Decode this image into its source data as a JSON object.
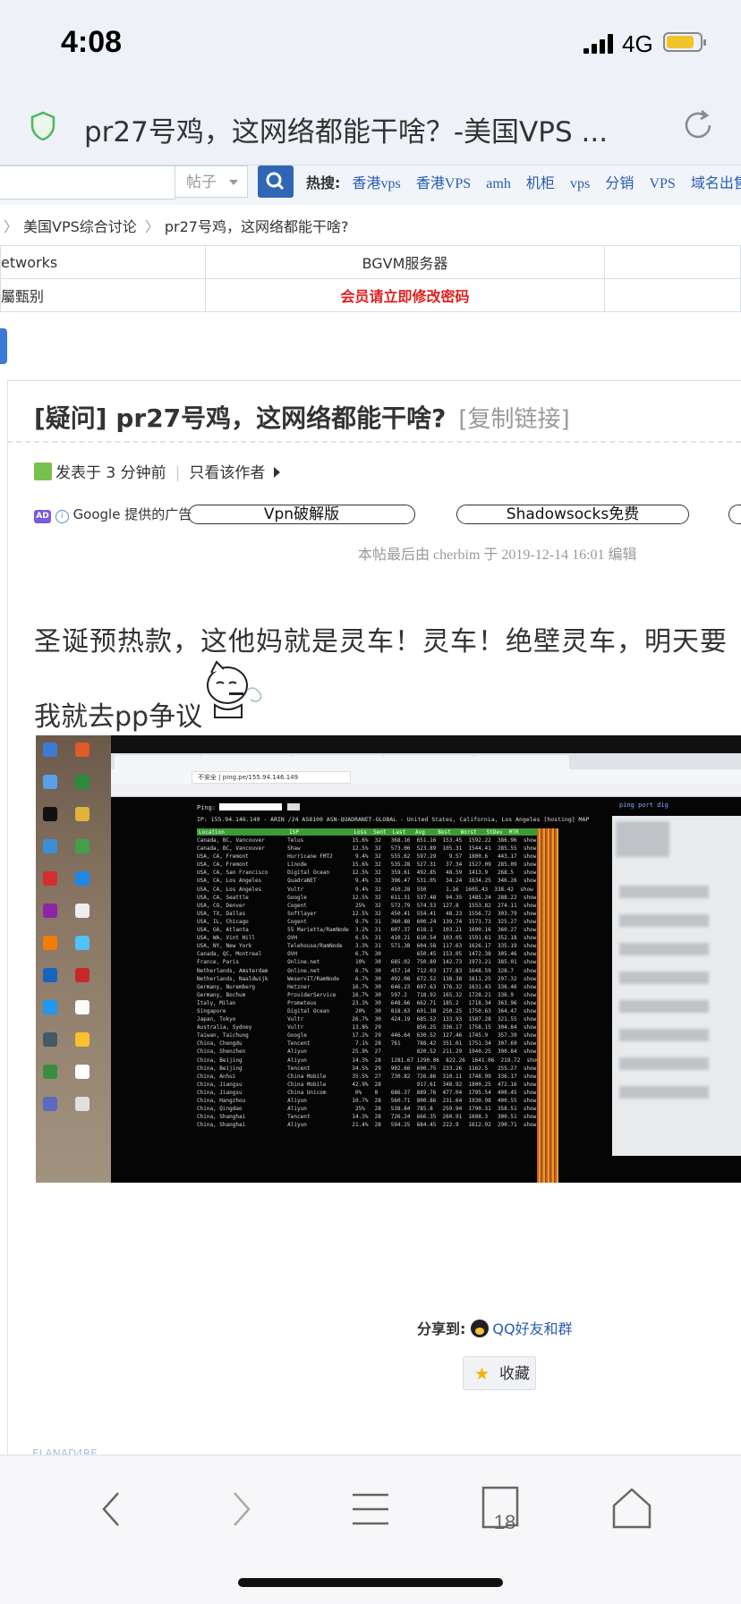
{
  "status": {
    "time": "4:08",
    "network": "4G"
  },
  "browser": {
    "page_title": "pr27号鸡，这网络都能干啥？-美国VPS ..."
  },
  "site_search": {
    "scope": "帖子",
    "hot_label": "热搜:",
    "hot_words": [
      "香港vps",
      "香港VPS",
      "amh",
      "机柜",
      "vps",
      "分销",
      "VPS",
      "域名出售",
      "比"
    ]
  },
  "breadcrumb": [
    "美国VPS综合讨论",
    "pr27号鸡，这网络都能干啥?"
  ],
  "links_table": {
    "row1": [
      "etworks",
      "BGVM服务器"
    ],
    "row2": [
      "屬甄别",
      "会员请立即修改密码"
    ]
  },
  "post": {
    "title": "[疑问] pr27号鸡，这网络都能干啥?",
    "copy_link": "[复制链接]",
    "posted": "发表于 3 分钟前",
    "only_author": "只看该作者",
    "ad": {
      "badge": "AD",
      "provider": "Google 提供的广告",
      "pills": [
        "Vpn破解版",
        "Shadowsocks免费"
      ]
    },
    "edit_note": "本帖最后由 cherbim 于 2019-12-14 16:01 编辑",
    "body_line1": "圣诞预热款，这他妈就是灵车！灵车！绝壁灵车，明天要",
    "body_line2": "我就去pp争议"
  },
  "embedded_screenshot": {
    "url": "不安全 | ping.pe/155.94.146.149",
    "ping_label": "Ping:",
    "ping_value": "155.94.1",
    "go_label": "Go",
    "right_links": "ping  port  dig",
    "ip_line": "IP: 155.94.146.149 - ARIN /24 AS8100 ASN-QUADRANET-GLOBAL - United States, California, Los Angeles [hosting] MAP",
    "header": "Location                    ISP                 Loss  Sent  Last   Avg    Best   Worst   StDev  MTR",
    "rows": [
      "Canada, BC, Vancouver       Telus               15.6%  32   368.16  651.16  153.45  1592.22  386.96  show",
      "Canada, BC, Vancouver       Shaw                12.5%  32   573.06  523.89  105.31  1544.41  285.55  show",
      "USA, CA, Fremont            Hurricane FMT2       9.4%  32   555.62  597.29    9.57  1800.6   443.17  show",
      "USA, CA, Fremont            Linode              15.6%  32   535.28  527.31   37.34  1527.09  285.09  show",
      "USA, CA, San Francisco      Digital Ocean       12.5%  32   359.61  492.85   48.59  1413.9   268.5   show",
      "USA, CA, Los Angeles        QuadraNET            9.4%  32   396.47  531.05   34.24  1634.25  346.26  show",
      "USA, CA, Los Angeles        Vultr                9.4%  32   410.28  550      1.16  1605.43  338.42  show",
      "USA, CA, Seattle            Google              12.5%  32   611.31  537.48   94.35  1485.24  288.22  show",
      "USA, CO, Denver             Cogent               25%   32   572.79  574.53  127.8   1553.82  274.11  show",
      "USA, TX, Dallas             Softlayer           12.5%  32   450.41  554.41   48.23  1556.72  303.79  show",
      "USA, IL, Chicago            Cogent               9.7%  31   360.88  600.24  139.74  1573.73  325.27  show",
      "USA, GA, Atlanta            55 Marietta/RamNode  3.2%  31   607.37  618.1   103.21  1690.16  360.27  show",
      "USA, WA, Vint Hill          OVH                  6.5%  31   410.21  610.54  103.05  1591.61  352.18  show",
      "USA, NY, New York           Telehouse/RamNode    3.3%  31   571.38  604.58  117.63  1626.17  335.19  show",
      "Canada, QC, Montreal        OVH                  6.7%  30           650.45  153.05  1472.38  305.46  show",
      "France, Paris               Online.net           10%   30   685.02  750.89  142.73  1973.21  385.01  show",
      "Netherlands, Amsterdam      Online.net           6.7%  30   457.14  712.03  177.83  1648.59  328.7   show",
      "Netherlands, Naaldwijk      WeservIT/RamNode     6.7%  30   492.08  672.52  138.38  1611.25  297.32  show",
      "Germany, Nuremberg          Hetzner             16.7%  30   646.23  697.63  176.32  1631.43  336.46  show",
      "Germany, Bochum             ProviderService     16.7%  30   597.2   718.92  165.32  1728.21  336.9   show",
      "Italy, Milan                Prometeus           23.3%  30   648.66  662.71  185.2   1718.34  363.96  show",
      "Singapore                   Digital Ocean        20%   30   818.63  691.38  250.25  1750.63  364.47  show",
      "Japan, Tokyo                Vultr               26.7%  30   424.19  685.52  133.93  1587.28  321.55  show",
      "Australia, Sydney           Vultr               13.8%  29           856.25  336.17  1758.15  304.84  show",
      "Taiwan, Taichung            Google              17.2%  29   446.64  630.52  127.46  1745.9   357.39  show",
      "China, Chengdu              Tencent              7.1%  28   761     788.42  351.01  1751.34  307.69  show",
      "China, Shenzhen             Aliyun              25.9%  27           820.52  211.29  1940.25  390.84  show",
      "China, Beijing              Aliyun              14.3%  28   1281.67 1290.06  822.26  1641.06  219.72  show",
      "China, Beijing              Tencent             34.5%  29   902.66  690.75  233.26  1162.5   255.27  show",
      "China, Anhui                China Mobile        35.5%  27   730.82  726.86  310.11  1748.99  336.17  show",
      "China, Jiangsu              China Mobile        42.9%  28           917.61  348.92  1800.25  472.16  show",
      "China, Jiangsu              China Unicom         0%    8    686.37  889.76  477.04  1795.54  400.45  show",
      "China, Hangzhou             Aliyun              10.7%  28   560.71  800.86  231.64  1930.98  400.55  show",
      "China, Qingdao              Aliyun               25%   28   538.84  785.8   259.94  1790.31  358.51  show",
      "China, Shanghai             Tencent             14.3%  28   726.24  666.35  260.91  1608.3   300.51  show",
      "China, Shanghai             Aliyun              21.4%  28   594.25  684.45  222.9   1612.92  290.71  show"
    ]
  },
  "share": {
    "label": "分享到:",
    "qq_label": "QQ好友和群",
    "favorite": "收藏"
  },
  "cutoff_text": "ELANAD4RE...",
  "toolbar": {
    "tab_count": "18"
  },
  "colors": {
    "accent": "#2a5bb3",
    "search_button": "#2f67b5",
    "warning": "#e02020",
    "battery": "#f2c42c"
  }
}
